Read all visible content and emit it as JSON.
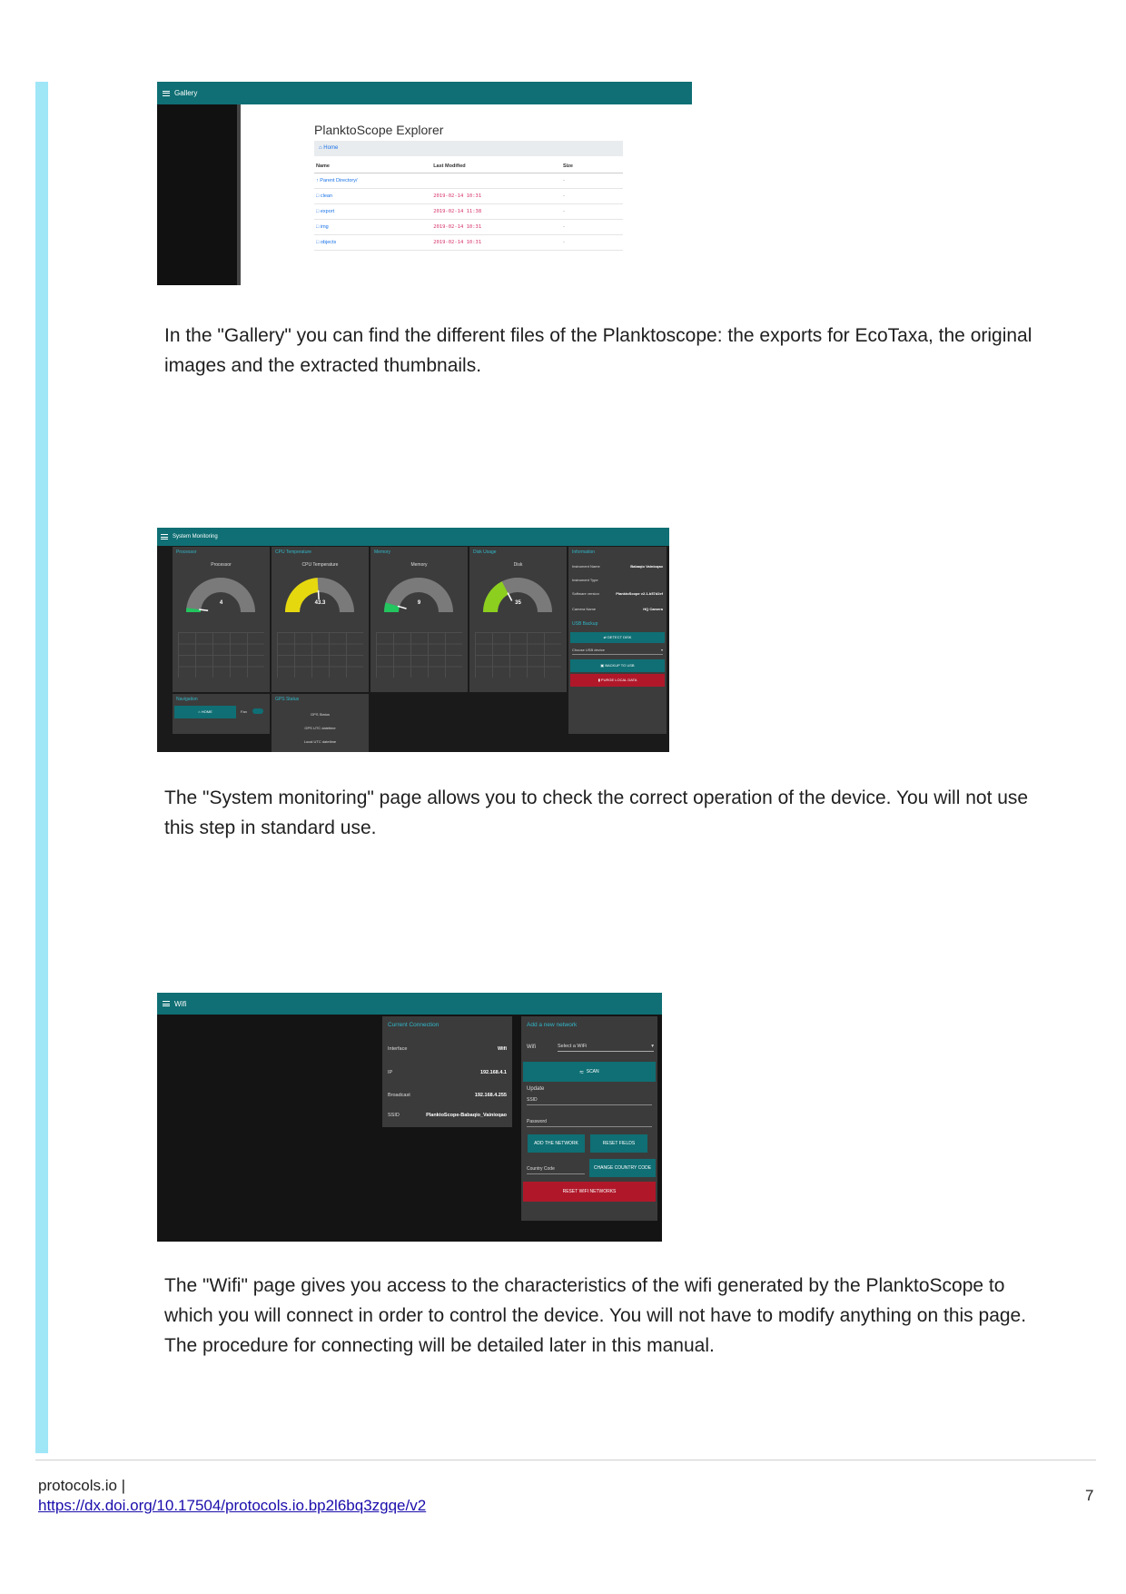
{
  "gallery": {
    "bar_title": "Gallery",
    "explorer_title": "PlanktoScope Explorer",
    "breadcrumb": "Home",
    "columns": [
      "Name",
      "Last Modified",
      "Size"
    ],
    "rows": [
      {
        "name": "Parent Directory/",
        "modified": "",
        "size": "-"
      },
      {
        "name": "clean",
        "modified": "2019-02-14 10:31",
        "size": "-"
      },
      {
        "name": "export",
        "modified": "2019-02-14 11:38",
        "size": "-"
      },
      {
        "name": "img",
        "modified": "2019-02-14 10:31",
        "size": "-"
      },
      {
        "name": "objects",
        "modified": "2019-02-14 10:31",
        "size": "-"
      }
    ]
  },
  "gallery_text": "In the \"Gallery\" you can find the different files of the Planktoscope: the exports for EcoTaxa, the original images and the extracted thumbnails.",
  "sysmon": {
    "bar_title": "System Monitoring",
    "panels": [
      {
        "title": "Processor",
        "label": "Processor",
        "value": "4",
        "percent": 4,
        "color": "#22c55e"
      },
      {
        "title": "CPU Temperature",
        "label": "CPU Temperature",
        "value": "43.3",
        "percent": 48,
        "color": "#e5d80f"
      },
      {
        "title": "Memory",
        "label": "Memory",
        "value": "9",
        "percent": 9,
        "color": "#22c55e"
      },
      {
        "title": "Disk Usage",
        "label": "Disk",
        "value": "35",
        "percent": 35,
        "color": "#8ccf1e"
      }
    ],
    "information": {
      "title": "Information",
      "rows": [
        {
          "k": "Instrument Name",
          "v": "Babaqio Vainioqao"
        },
        {
          "k": "Instrument Type",
          "v": ""
        },
        {
          "k": "Software version",
          "v": "PlanktoScope v2.1-b57d2ef"
        },
        {
          "k": "Camera Name",
          "v": "HQ Camera"
        }
      ],
      "usb_title": "USB Backup",
      "detect_label": "DETECT DISK",
      "choose_label": "Choose USB device",
      "backup_label": "BACKUP TO USB",
      "purge_label": "PURGE LOCAL DATA"
    },
    "navigation": {
      "title": "Navigation",
      "home_label": "HOME",
      "fan_label": "Fan"
    },
    "gps": {
      "title": "GPS Status",
      "items": [
        "GPS Status",
        "GPS UTC datetime",
        "Local UTC datetime"
      ]
    }
  },
  "sysmon_text": "The \"System monitoring\" page allows you to check the correct operation of the device. You will not use this step in standard use.",
  "wifi": {
    "bar_title": "Wifi",
    "current": {
      "title": "Current Connection",
      "rows": [
        {
          "k": "Interface",
          "v": "Wifi"
        },
        {
          "k": "IP",
          "v": "192.168.4.1"
        },
        {
          "k": "Broadcast",
          "v": "192.168.4.255"
        },
        {
          "k": "SSID",
          "v": "PlanktoScope-Babaqio_Vainioqao"
        }
      ]
    },
    "add": {
      "title": "Add a new network",
      "wifi_label": "Wifi",
      "select_placeholder": "Select a WiFi",
      "scan_label": "SCAN",
      "update_label": "Update",
      "ssid_label": "SSID",
      "password_label": "Password",
      "add_label": "ADD THE NETWORK",
      "reset_fields_label": "RESET FIELDS",
      "country_label": "Country Code",
      "change_country_label": "CHANGE COUNTRY CODE",
      "reset_wifi_label": "RESET WIFI NETWORKS"
    }
  },
  "wifi_text": "The \"Wifi\" page gives you access to the characteristics of the wifi generated by the PlanktoScope to which you will connect in order to control the device. You will not have to modify anything on this page. The procedure for connecting will be detailed later in this manual.",
  "footer": {
    "site": "protocols.io |",
    "link": "https://dx.doi.org/10.17504/protocols.io.bp2l6bq3zgqe/v2",
    "page": "7"
  }
}
